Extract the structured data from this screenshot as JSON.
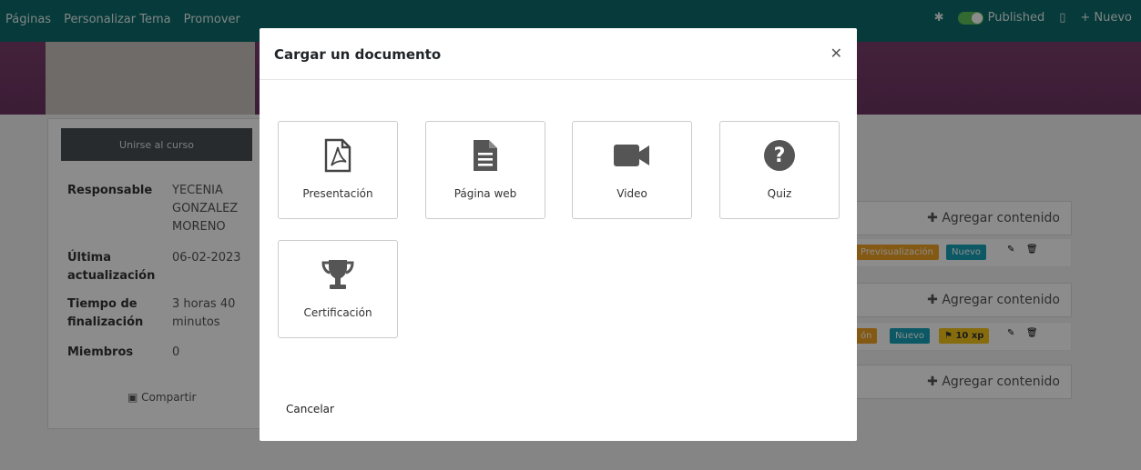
{
  "topbar": {
    "nav": [
      "Páginas",
      "Personalizar Tema",
      "Promover"
    ],
    "published": "Published",
    "new": "Nuevo"
  },
  "course": {
    "join": "Unirse al curso",
    "meta": [
      {
        "k": "Responsable",
        "v": "YECENIA GONZALEZ MORENO"
      },
      {
        "k": "Última actualización",
        "v": "06-02-2023"
      },
      {
        "k": "Tiempo de finalización",
        "v": "3 horas 40 minutos"
      },
      {
        "k": "Miembros",
        "v": "0"
      }
    ],
    "share": "Compartir"
  },
  "content": {
    "add_label": "Agregar contenido",
    "tag_preview": "Previsualización",
    "tag_preview_partial": "ón",
    "tag_new": "Nuevo",
    "tag_xp": "10 xp"
  },
  "modal": {
    "title": "Cargar un documento",
    "options": [
      {
        "label": "Presentación",
        "icon": "file-pdf-icon"
      },
      {
        "label": "Página web",
        "icon": "file-text-icon"
      },
      {
        "label": "Video",
        "icon": "video-camera-icon"
      },
      {
        "label": "Quiz",
        "icon": "question-circle-icon"
      },
      {
        "label": "Certificación",
        "icon": "trophy-icon"
      }
    ],
    "cancel": "Cancelar"
  }
}
